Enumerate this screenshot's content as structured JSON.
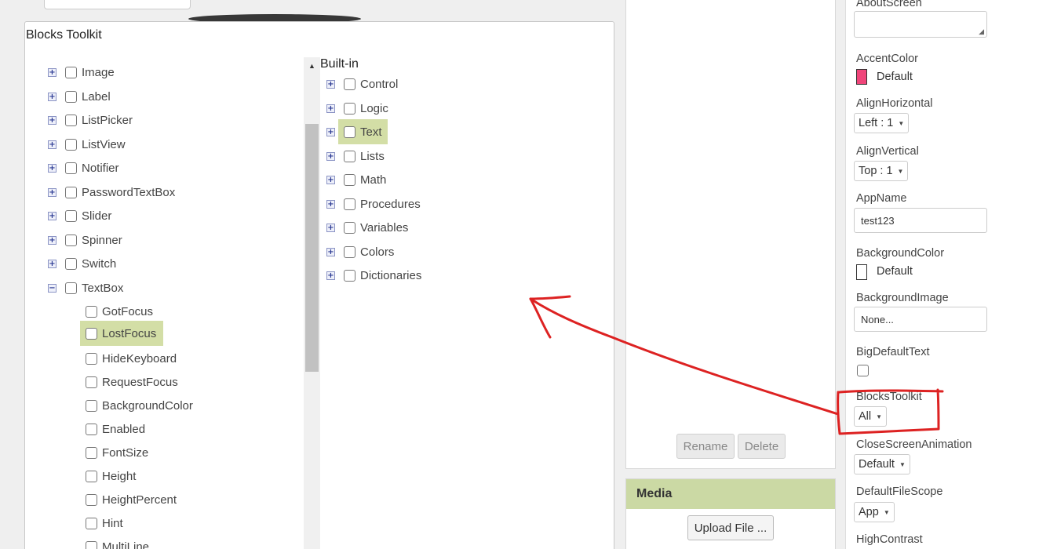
{
  "dialog": {
    "title": "Blocks Toolkit",
    "component_items": [
      {
        "label": "Image",
        "state": "collapsed"
      },
      {
        "label": "Label",
        "state": "collapsed"
      },
      {
        "label": "ListPicker",
        "state": "collapsed"
      },
      {
        "label": "ListView",
        "state": "collapsed"
      },
      {
        "label": "Notifier",
        "state": "collapsed"
      },
      {
        "label": "PasswordTextBox",
        "state": "collapsed"
      },
      {
        "label": "Slider",
        "state": "collapsed"
      },
      {
        "label": "Spinner",
        "state": "collapsed"
      },
      {
        "label": "Switch",
        "state": "collapsed"
      },
      {
        "label": "TextBox",
        "state": "expanded"
      }
    ],
    "textbox_children": [
      {
        "label": "GotFocus"
      },
      {
        "label": "LostFocus",
        "highlighted": true
      },
      {
        "label": "HideKeyboard"
      },
      {
        "label": "RequestFocus"
      },
      {
        "label": "BackgroundColor"
      },
      {
        "label": "Enabled"
      },
      {
        "label": "FontSize"
      },
      {
        "label": "Height"
      },
      {
        "label": "HeightPercent"
      },
      {
        "label": "Hint"
      },
      {
        "label": "MultiLine"
      }
    ],
    "builtin_title": "Built-in",
    "builtin_items": [
      {
        "label": "Control"
      },
      {
        "label": "Logic"
      },
      {
        "label": "Text",
        "highlighted": true
      },
      {
        "label": "Lists"
      },
      {
        "label": "Math"
      },
      {
        "label": "Procedures"
      },
      {
        "label": "Variables"
      },
      {
        "label": "Colors"
      },
      {
        "label": "Dictionaries"
      }
    ]
  },
  "components_panel": {
    "rename_label": "Rename",
    "delete_label": "Delete"
  },
  "media": {
    "title": "Media",
    "upload_label": "Upload File ..."
  },
  "properties": {
    "about_screen_label": "AboutScreen",
    "about_screen_value": "",
    "accent_color_label": "AccentColor",
    "accent_color_value": "Default",
    "accent_color_hex": "#f0457a",
    "align_horizontal_label": "AlignHorizontal",
    "align_horizontal_value": "Left : 1",
    "align_vertical_label": "AlignVertical",
    "align_vertical_value": "Top : 1",
    "app_name_label": "AppName",
    "app_name_value": "test123",
    "background_color_label": "BackgroundColor",
    "background_color_value": "Default",
    "background_color_hex": "#ffffff",
    "background_image_label": "BackgroundImage",
    "background_image_value": "None...",
    "big_default_text_label": "BigDefaultText",
    "big_default_text_checked": false,
    "blocks_toolkit_label": "BlocksToolkit",
    "blocks_toolkit_value": "All",
    "close_screen_animation_label": "CloseScreenAnimation",
    "close_screen_animation_value": "Default",
    "default_file_scope_label": "DefaultFileScope",
    "default_file_scope_value": "App",
    "high_contrast_label": "HighContrast"
  },
  "colors": {
    "highlight": "#d3dea6",
    "media_header": "#cbd9a4",
    "annotation": "#dd2222"
  }
}
